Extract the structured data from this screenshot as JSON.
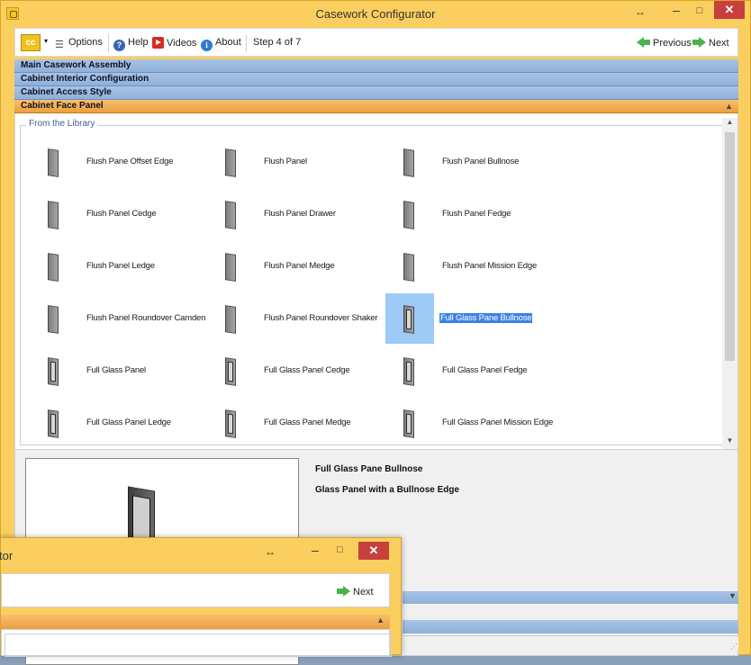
{
  "window": {
    "title": "Casework Configurator",
    "move_glyph": "↔",
    "minimize_glyph": "–",
    "maximize_glyph": "□",
    "close_glyph": "✕"
  },
  "toolbar": {
    "logo_text": "cc",
    "options_label": "Options",
    "help_label": "Help",
    "videos_label": "Videos",
    "about_label": "About",
    "step_label": "Step 4 of 7",
    "previous_label": "Previous",
    "next_label": "Next"
  },
  "accordion": [
    {
      "label": "Main Casework Assembly"
    },
    {
      "label": "Cabinet Interior Configuration"
    },
    {
      "label": "Cabinet Access Style"
    },
    {
      "label": "Cabinet Face Panel"
    }
  ],
  "library": {
    "legend": "From the Library",
    "items": [
      {
        "label": "Flush Pane Offset Edge",
        "glass": false
      },
      {
        "label": "Flush Panel",
        "glass": false
      },
      {
        "label": "Flush Panel Bullnose",
        "glass": false
      },
      {
        "label": "Flush Panel Cedge",
        "glass": false
      },
      {
        "label": "Flush Panel Drawer",
        "glass": false
      },
      {
        "label": "Flush Panel Fedge",
        "glass": false
      },
      {
        "label": "Flush Panel Ledge",
        "glass": false
      },
      {
        "label": "Flush Panel Medge",
        "glass": false
      },
      {
        "label": "Flush Panel Mission Edge",
        "glass": false
      },
      {
        "label": "Flush Panel Roundover Camden",
        "glass": false
      },
      {
        "label": "Flush Panel Roundover Shaker",
        "glass": false
      },
      {
        "label": "Full Glass Pane Bullnose",
        "glass": true,
        "selected": true
      },
      {
        "label": "Full Glass Panel",
        "glass": true
      },
      {
        "label": "Full Glass Panel Cedge",
        "glass": true
      },
      {
        "label": "Full Glass Panel Fedge",
        "glass": true
      },
      {
        "label": "Full Glass Panel Ledge",
        "glass": true
      },
      {
        "label": "Full Glass Panel Medge",
        "glass": true
      },
      {
        "label": "Full Glass Panel Mission Edge",
        "glass": true
      }
    ]
  },
  "detail": {
    "title": "Full Glass Pane Bullnose",
    "description": "Glass Panel with a Bullnose Edge"
  },
  "second_window": {
    "title_fragment": "tor",
    "next_label": "Next"
  }
}
